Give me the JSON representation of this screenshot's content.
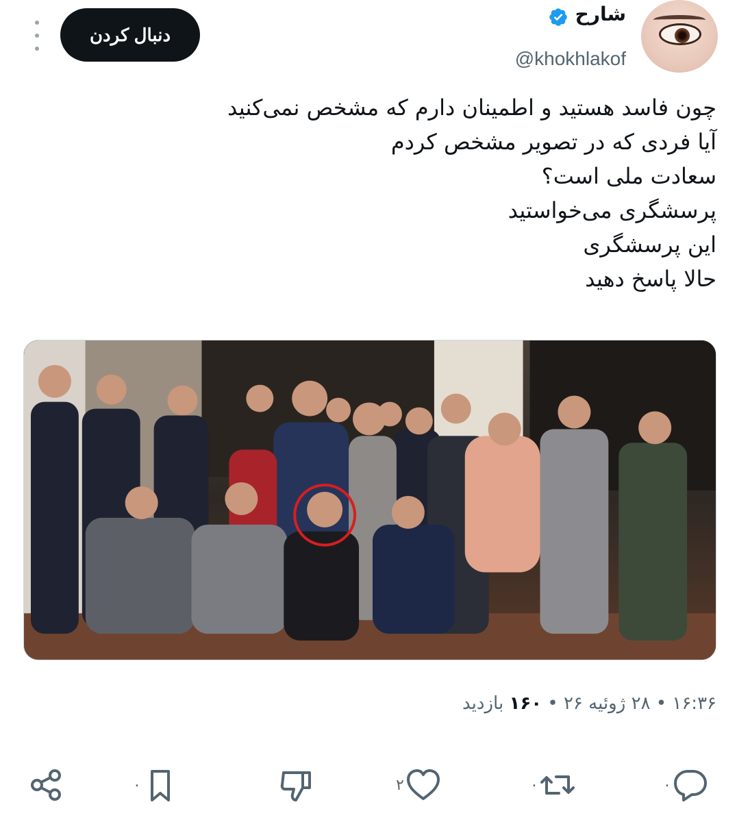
{
  "user": {
    "display_name": "شارح",
    "handle": "@khokhlakof",
    "verified": true,
    "avatar_icon": "avatar-eye-icon"
  },
  "header": {
    "follow_label": "دنبال کردن",
    "more_icon": "more-options-icon"
  },
  "tweet": {
    "lines": [
      "چون فاسد هستید و اطمینان دارم که مشخص نمی‌کنید",
      "آیا فردی که در تصویر مشخص کردم",
      "سعادت ملی است؟",
      "پرسشگری می‌خواستید",
      "این پرسشگری",
      "حالا پاسخ دهید"
    ]
  },
  "media": {
    "highlight_color": "#d81e1e"
  },
  "meta": {
    "time": "۱۶:۳۶",
    "date": "۲۸ ژوئیه ۲۶",
    "views_count": "۱۶۰",
    "views_label": "بازدید",
    "separator": "•"
  },
  "actions": {
    "reply_count": "۰",
    "retweet_count": "۰",
    "like_count": "۲",
    "bookmark_count": "۰"
  },
  "colors": {
    "text": "#0f1419",
    "secondary": "#536471",
    "verified": "#1d9bf0",
    "icon": "#536471"
  }
}
